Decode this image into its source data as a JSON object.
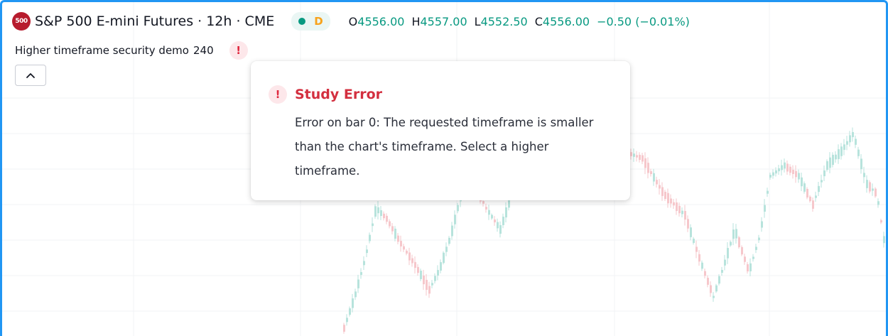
{
  "symbol": {
    "badge": "500",
    "title": "S&P 500 E-mini Futures · 12h · CME",
    "status_letter": "D"
  },
  "ohlc": {
    "open_label": "O",
    "open": "4556.00",
    "high_label": "H",
    "high": "4557.00",
    "low_label": "L",
    "low": "4552.50",
    "close_label": "C",
    "close": "4556.00",
    "change": "−0.50 (−0.01%)"
  },
  "study": {
    "name": "Higher timeframe security demo",
    "length": "240",
    "error_glyph": "!"
  },
  "tooltip": {
    "icon_glyph": "!",
    "title": "Study Error",
    "body": "Error on bar 0: The requested timeframe is smaller than the chart's timeframe. Select a higher timeframe."
  },
  "colors": {
    "frame_border": "#2196f3",
    "up_candle": "#b7e3dc",
    "down_candle": "#f6c7cb",
    "ohlc_value": "#089981",
    "error_red": "#d32f3f",
    "badge_red": "#b71c2e",
    "status_dot": "#089981",
    "status_letter": "#f7a21b"
  },
  "icons": {
    "collapse": "chevron-up-icon",
    "error": "exclamation-icon",
    "symbol": "sp500-logo-icon"
  }
}
